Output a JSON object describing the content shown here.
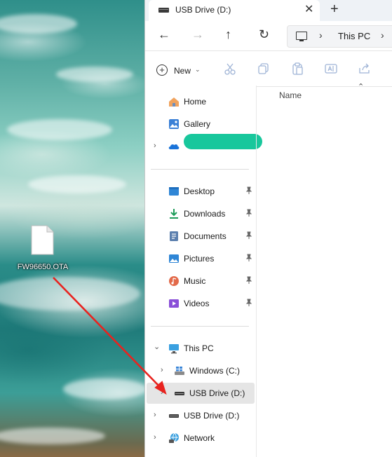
{
  "desktop": {
    "file_label": "FW96650.OTA",
    "colors": {
      "arrow": "#e8231f"
    }
  },
  "window": {
    "tab": {
      "title": "USB Drive (D:)",
      "close": "✕",
      "new_tab": "+"
    },
    "nav": {
      "back": "←",
      "forward": "→",
      "up": "↑",
      "refresh": "↻"
    },
    "address": {
      "sep1": "›",
      "text": "This PC",
      "sep2": "›"
    },
    "toolbar": {
      "new_label": "New",
      "new_chevron": "⌄",
      "new_plus": "+"
    },
    "content": {
      "column_name": "Name",
      "sort_caret": "⌃"
    },
    "sidebar": {
      "quick": [
        {
          "label": "Home",
          "icon": "home-icon"
        },
        {
          "label": "Gallery",
          "icon": "gallery-icon"
        },
        {
          "label": "",
          "icon": "onedrive-icon"
        }
      ],
      "pinned": [
        {
          "label": "Desktop",
          "icon": "desktop-folder-icon"
        },
        {
          "label": "Downloads",
          "icon": "downloads-icon"
        },
        {
          "label": "Documents",
          "icon": "documents-icon"
        },
        {
          "label": "Pictures",
          "icon": "pictures-icon"
        },
        {
          "label": "Music",
          "icon": "music-icon"
        },
        {
          "label": "Videos",
          "icon": "videos-icon"
        }
      ],
      "devices": [
        {
          "label": "This PC",
          "icon": "this-pc-icon"
        },
        {
          "label": "Windows (C:)",
          "icon": "windows-drive-icon"
        },
        {
          "label": "USB Drive (D:)",
          "icon": "usb-drive-icon"
        },
        {
          "label": "USB Drive (D:)",
          "icon": "usb-drive-icon"
        },
        {
          "label": "Network",
          "icon": "network-icon"
        }
      ],
      "chevron_right": "›",
      "chevron_down": "⌄"
    }
  }
}
